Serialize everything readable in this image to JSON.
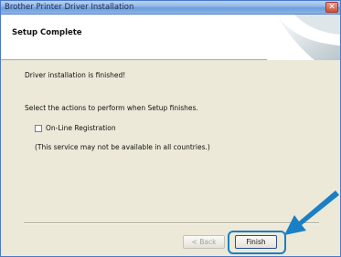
{
  "window": {
    "title": "Brother Printer Driver Installation",
    "close_glyph": "✕"
  },
  "header": {
    "title": "Setup Complete"
  },
  "content": {
    "status_text": "Driver installation is finished!",
    "instruction_text": "Select the actions to perform when Setup finishes.",
    "checkbox_label": "On-Line Registration",
    "checkbox_checked": false,
    "note_text": "(This service may not be available in all countries.)"
  },
  "buttons": {
    "back_label": "< Back",
    "finish_label": "Finish"
  },
  "colors": {
    "highlight": "#1a7fc4",
    "arrow": "#1a7fc4"
  }
}
